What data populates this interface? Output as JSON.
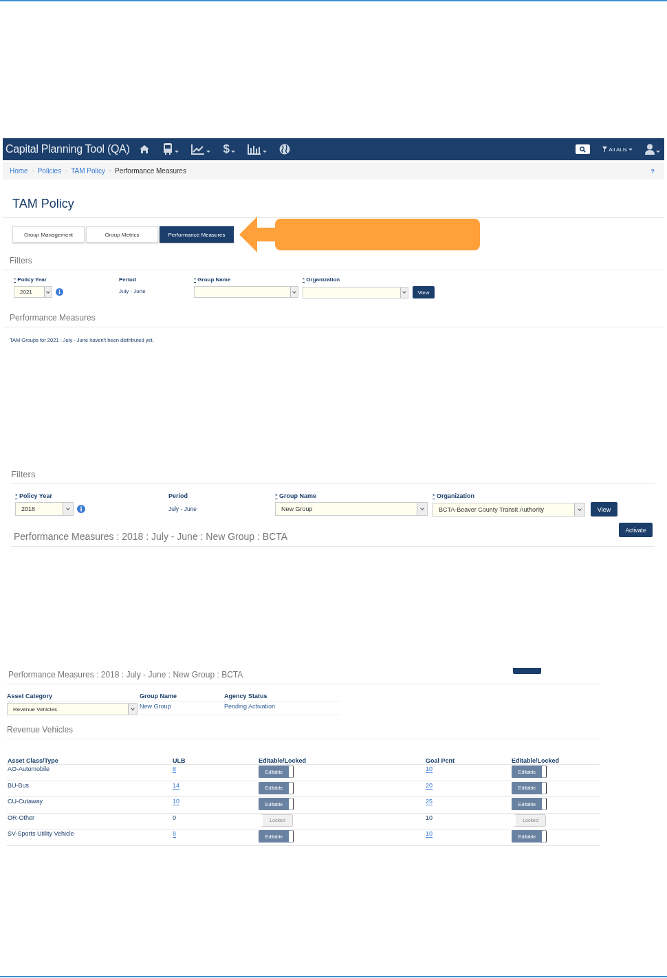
{
  "screenshot_1": {
    "navbar": {
      "title": "Capital Planning Tool (QA)",
      "menus": [
        {
          "kind": "home",
          "caret": false
        },
        {
          "kind": "bus",
          "caret": true
        },
        {
          "kind": "chart",
          "caret": true
        },
        {
          "kind": "dollar",
          "symbol": "$",
          "caret": true
        },
        {
          "kind": "bars",
          "caret": true
        },
        {
          "kind": "globe",
          "caret": false
        }
      ],
      "filter_label": "All ALIs"
    },
    "breadcrumb": [
      "Home",
      "Policies",
      "TAM Policy",
      "Performance Measures"
    ],
    "help": "?",
    "page_title": "TAM Policy",
    "tabs": [
      {
        "label": "Group Management",
        "selected": false
      },
      {
        "label": "Group Metrics",
        "selected": false
      },
      {
        "label": "Performance Measures",
        "selected": true
      }
    ],
    "filters_heading": "Filters",
    "filters": {
      "policy_year": {
        "mark": "*",
        "label": "Policy Year",
        "value": "2021"
      },
      "period": {
        "label": "Period",
        "value": "July - June"
      },
      "group_name": {
        "mark": "*",
        "label": "Group Name"
      },
      "organization": {
        "mark": "*",
        "label": "Organization"
      },
      "view_button": "View"
    },
    "section_heading": "Performance Measures",
    "message": "TAM Groups for 2021 : July - June haven't been distributed yet."
  },
  "screenshot_2": {
    "filters_heading": "Filters",
    "filters": {
      "policy_year": {
        "mark": "*",
        "label": "Policy Year",
        "value": "2018"
      },
      "period": {
        "label": "Period",
        "value": "July - June"
      },
      "group_name": {
        "mark": "*",
        "label": "Group Name",
        "value": "New Group"
      },
      "organization": {
        "mark": "*",
        "label": "Organization",
        "value": "BCTA-Beaver County Transit Authority"
      },
      "view_button": "View"
    },
    "activate_button": "Activate",
    "section_heading": "Performance Measures : 2018 : July - June : New Group : BCTA"
  },
  "screenshot_3": {
    "section_heading": "Performance Measures : 2018 : July - June : New Group : BCTA",
    "asset_category": {
      "label": "Asset Category",
      "value": "Revenue Vehicles"
    },
    "group_name": {
      "label": "Group Name",
      "value": "New Group"
    },
    "agency_status": {
      "label": "Agency Status",
      "value": "Pending Activation"
    },
    "table_heading": "Revenue Vehicles",
    "columns": [
      "Asset Class/Type",
      "ULB",
      "Editable/Locked",
      "Goal Pcnt",
      "Editable/Locked"
    ],
    "rows": [
      {
        "type": "AO-Automobile",
        "ulb": "8",
        "ulb_editable": true,
        "ulb_toggle": "Editable",
        "goal": "10",
        "goal_editable": true,
        "goal_toggle": "Editable"
      },
      {
        "type": "BU-Bus",
        "ulb": "14",
        "ulb_editable": true,
        "ulb_toggle": "Editable",
        "goal": "20",
        "goal_editable": true,
        "goal_toggle": "Editable"
      },
      {
        "type": "CU-Cutaway",
        "ulb": "10",
        "ulb_editable": true,
        "ulb_toggle": "Editable",
        "goal": "25",
        "goal_editable": true,
        "goal_toggle": "Editable"
      },
      {
        "type": "OR-Other",
        "ulb": "0",
        "ulb_editable": false,
        "ulb_toggle": "Locked",
        "goal": "10",
        "goal_editable": false,
        "goal_toggle": "Locked"
      },
      {
        "type": "SV-Sports Utility Vehicle",
        "ulb": "8",
        "ulb_editable": true,
        "ulb_toggle": "Editable",
        "goal": "10",
        "goal_editable": true,
        "goal_toggle": "Editable"
      }
    ]
  }
}
